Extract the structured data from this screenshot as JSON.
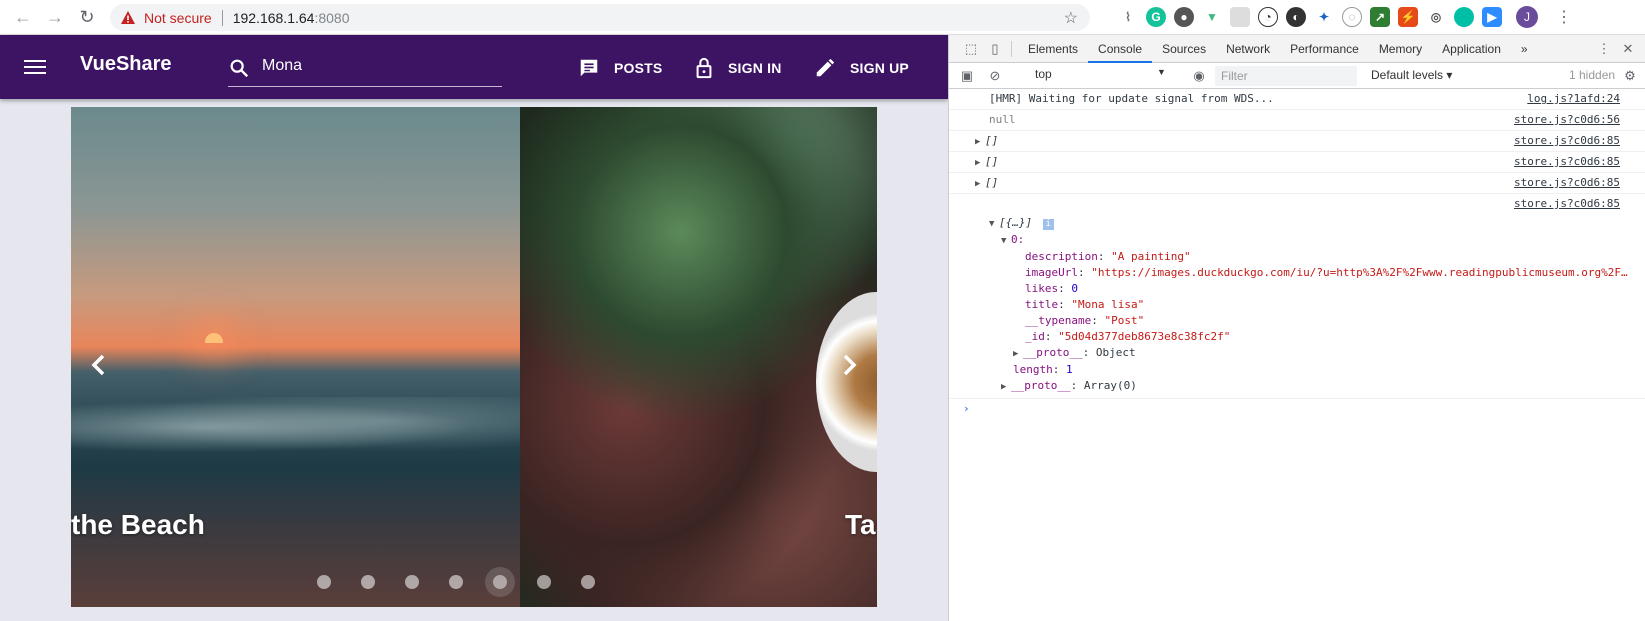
{
  "browser": {
    "not_secure": "Not secure",
    "host": "192.168.1.64",
    "port": ":8080",
    "avatar_initial": "J"
  },
  "app": {
    "brand": "VueShare",
    "search_value": "Mona",
    "nav": [
      "POSTS",
      "SIGN IN",
      "SIGN UP"
    ],
    "carousel": {
      "caption_left": "the Beach",
      "caption_right": "Tas",
      "dot_count": 7
    }
  },
  "devtools": {
    "tabs": [
      "Elements",
      "Console",
      "Sources",
      "Network",
      "Performance",
      "Memory",
      "Application"
    ],
    "more": "»",
    "context": "top",
    "filter_placeholder": "Filter",
    "levels": "Default levels ▾",
    "hidden": "1 hidden",
    "logs": [
      {
        "text": "[HMR] Waiting for update signal from WDS...",
        "src": "log.js?1afd:24"
      },
      {
        "text": "null",
        "src": "store.js?c0d6:56"
      },
      {
        "text": "[]",
        "src": "store.js?c0d6:85"
      },
      {
        "text": "[]",
        "src": "store.js?c0d6:85"
      },
      {
        "text": "[]",
        "src": "store.js?c0d6:85"
      },
      {
        "text": "",
        "src": "store.js?c0d6:85"
      }
    ],
    "object": {
      "header": "[{…}]",
      "index": "0:",
      "description_key": "description",
      "description_val": "\"A painting\"",
      "imageUrl_key": "imageUrl",
      "imageUrl_val": "\"https://images.duckduckgo.com/iu/?u=http%3A%2F%2Fwww.readingpublicmuseum.org%2F…",
      "likes_key": "likes",
      "likes_val": "0",
      "title_key": "title",
      "title_val": "\"Mona lisa\"",
      "typename_key": "__typename",
      "typename_val": "\"Post\"",
      "id_key": "_id",
      "id_val": "\"5d04d377deb8673e8c38fc2f\"",
      "proto_key": "__proto__",
      "proto_val": "Object",
      "length_key": "length",
      "length_val": "1",
      "array_proto_val": "Array(0)"
    }
  }
}
